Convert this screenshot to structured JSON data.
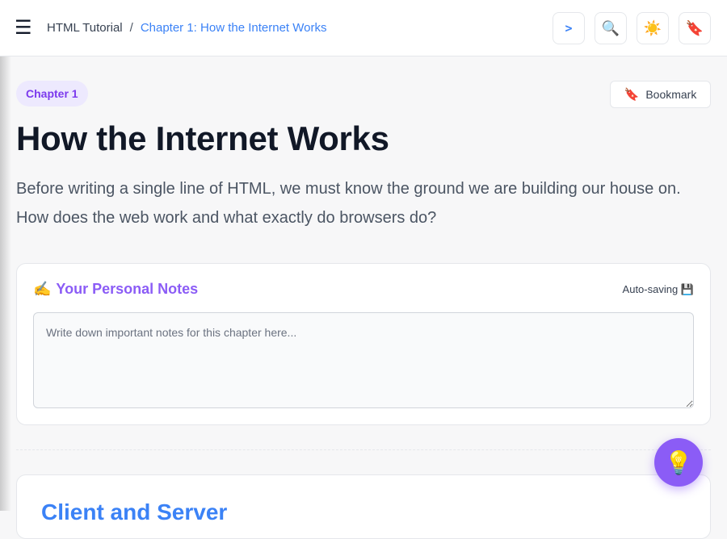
{
  "header": {
    "menu_icon": "☰",
    "breadcrumb_root": "HTML Tutorial",
    "breadcrumb_sep": "/",
    "breadcrumb_current": "Chapter 1: How the Internet Works",
    "code_label": ">",
    "search_icon": "🔍",
    "theme_icon": "☀️",
    "bookmark_icon": "🔖"
  },
  "chapter": {
    "badge": "Chapter 1",
    "bookmark_icon": "🔖",
    "bookmark_label": "Bookmark",
    "title": "How the Internet Works",
    "lead": "Before writing a single line of HTML, we must know the ground we are building our house on. How does the web work and what exactly do browsers do?"
  },
  "notes": {
    "icon": "✍️",
    "title": "Your Personal Notes",
    "autosave": "Auto-saving 💾",
    "placeholder": "Write down important notes for this chapter here..."
  },
  "section": {
    "title": "Client and Server"
  },
  "fab": {
    "icon": "💡"
  },
  "colors": {
    "accent_blue": "#3b82f6",
    "accent_purple": "#8b5cf6",
    "badge_bg": "#ede9fe"
  }
}
